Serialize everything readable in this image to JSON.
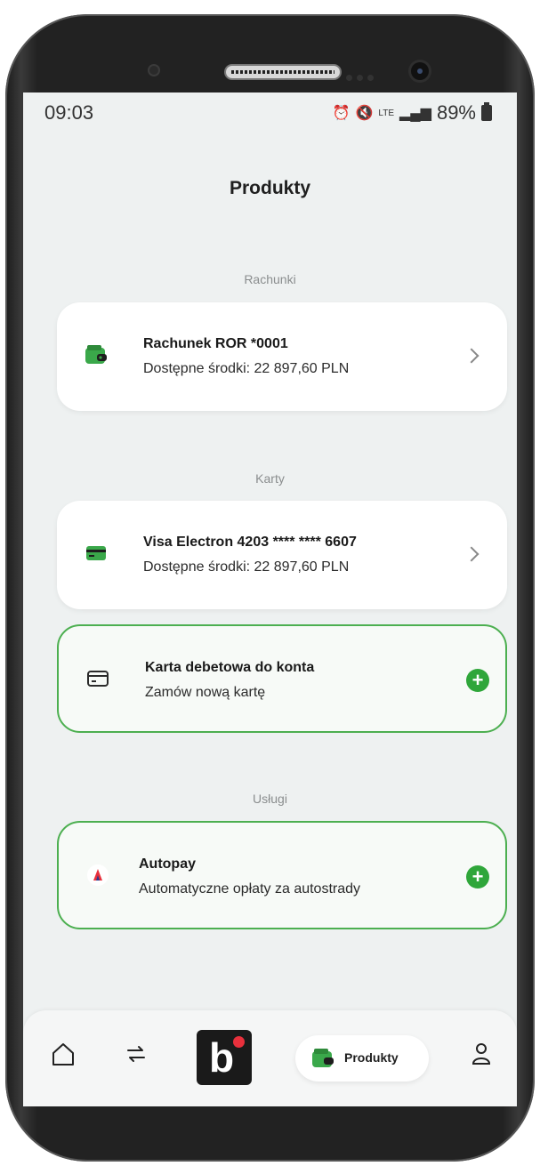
{
  "status_bar": {
    "time": "09:03",
    "network": "LTE",
    "battery": "89%"
  },
  "page": {
    "title": "Produkty"
  },
  "sections": {
    "accounts": {
      "label": "Rachunki",
      "items": [
        {
          "title": "Rachunek ROR *0001",
          "subtitle": "Dostępne środki: 22 897,60 PLN",
          "icon": "wallet-icon"
        }
      ]
    },
    "cards": {
      "label": "Karty",
      "items": [
        {
          "title": "Visa Electron 4203 **** **** 6607",
          "subtitle": "Dostępne środki: 22 897,60 PLN",
          "icon": "card-icon"
        }
      ],
      "add": {
        "title": "Karta debetowa do konta",
        "subtitle": "Zamów nową kartę",
        "icon": "card-outline-icon"
      }
    },
    "services": {
      "label": "Usługi",
      "add": {
        "title": "Autopay",
        "subtitle": "Automatyczne opłaty za autostrady",
        "icon": "autopay-logo-icon"
      }
    }
  },
  "bottom_nav": {
    "home_icon": "home-icon",
    "transfers_icon": "transfer-arrows-icon",
    "brand_icon": "bank-logo-icon",
    "products_label": "Produkty",
    "profile_icon": "profile-icon"
  },
  "colors": {
    "accent_green": "#2fa63a",
    "outline_green": "#4caf50",
    "background": "#eef1f1",
    "brand_red": "#e8303c"
  }
}
